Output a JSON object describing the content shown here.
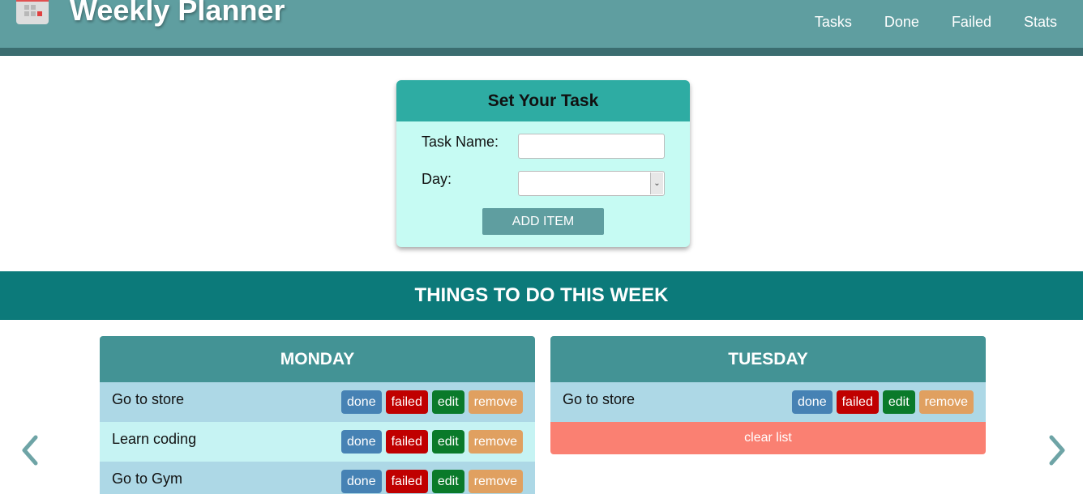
{
  "header": {
    "title": "Weekly Planner",
    "logo_icon": "calendar-icon",
    "nav": [
      "Tasks",
      "Done",
      "Failed",
      "Stats"
    ],
    "bg_color": "#5f9ea0"
  },
  "form": {
    "title": "Set Your Task",
    "task_name_label": "Task Name:",
    "task_name_value": "",
    "day_label": "Day:",
    "day_value": "",
    "add_button": "ADD ITEM"
  },
  "banner": {
    "title": "THINGS TO DO THIS WEEK"
  },
  "actions": {
    "done": "done",
    "failed": "failed",
    "edit": "edit",
    "remove": "remove"
  },
  "days": [
    {
      "name": "MONDAY",
      "tasks": [
        "Go to store",
        "Learn coding",
        "Go to Gym"
      ]
    },
    {
      "name": "TUESDAY",
      "tasks": [
        "Go to store"
      ],
      "clear_label": "clear list"
    }
  ],
  "colors": {
    "done": "#4682b4",
    "failed": "#c00000",
    "edit": "#0a7a2a",
    "remove": "#e0a060",
    "clear": "#fa8072"
  },
  "carousel": {
    "prev_icon": "chevron-left-icon",
    "next_icon": "chevron-right-icon"
  }
}
